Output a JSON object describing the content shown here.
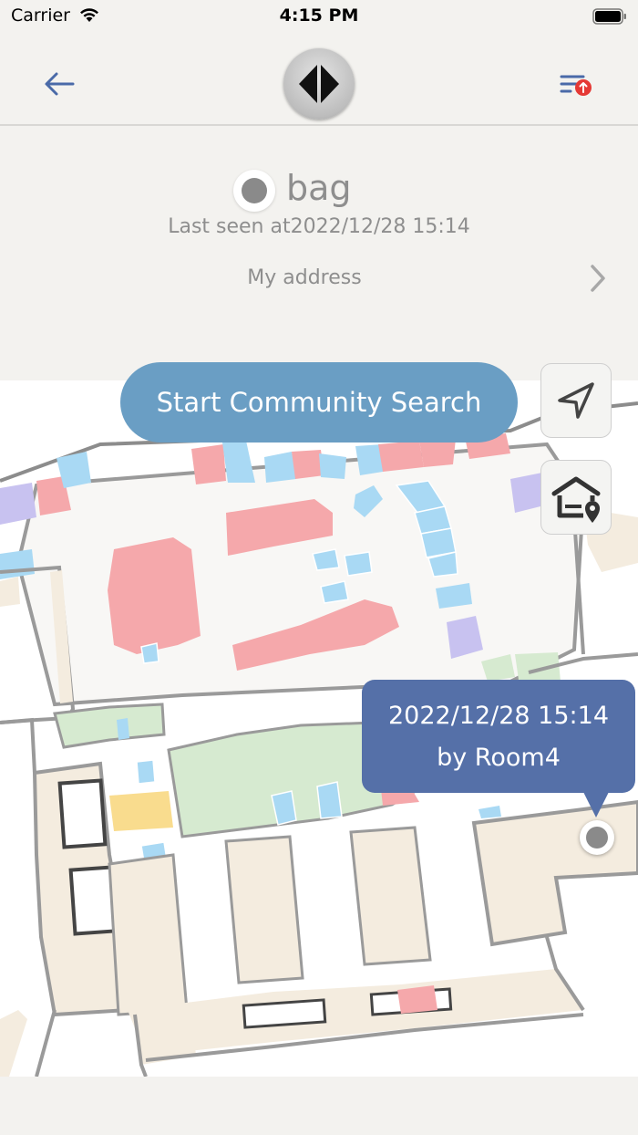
{
  "status_bar": {
    "carrier": "Carrier",
    "time": "4:15 PM"
  },
  "nav": {
    "back_icon": "arrow-left-icon",
    "logo_icon": "brand-logo",
    "filter_icon": "filter-alert-icon",
    "accent_color": "#4a6aa8",
    "badge_color": "#e53935"
  },
  "item": {
    "name": "bag",
    "last_seen": "Last seen at2022/12/28 15:14",
    "address_label": "My address"
  },
  "map": {
    "community_search_label": "Start Community Search",
    "callout": {
      "time": "2022/12/28 15:14",
      "by": "by Room4"
    },
    "controls": [
      "navigate-icon",
      "home-location-icon"
    ],
    "colors": {
      "shop_red": "#f5a8ab",
      "shop_blue": "#a9d9f4",
      "shop_purple": "#c8c2f0",
      "green_area": "#d6ead0",
      "yellow_area": "#f9dc8e",
      "tan_area": "#f4ecdf",
      "callout": "#5570a8",
      "search_button": "#6a9ec4"
    }
  }
}
